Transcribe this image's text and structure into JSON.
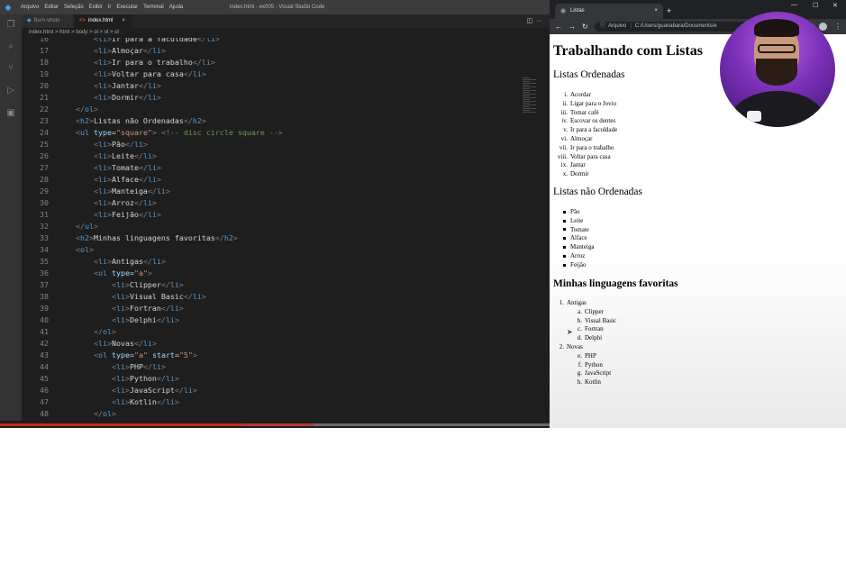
{
  "vscode": {
    "menu": [
      "Arquivo",
      "Editar",
      "Seleção",
      "Exibir",
      "Ir",
      "Executar",
      "Terminal",
      "Ajuda"
    ],
    "window_title": "index.html - ex005 - Visual Studio Code",
    "tabs": [
      {
        "label": "Bem-vindo",
        "active": false
      },
      {
        "label": "index.html",
        "active": true
      }
    ],
    "breadcrumb": "index.html > html > body > ol > ol > ol"
  },
  "code_lines": [
    {
      "n": "16",
      "indent": 2,
      "tokens": [
        {
          "t": "br",
          "v": "<"
        },
        {
          "t": "tag",
          "v": "li"
        },
        {
          "t": "br",
          "v": ">"
        },
        {
          "t": "txt",
          "v": "Ir para a faculdade"
        },
        {
          "t": "br",
          "v": "</"
        },
        {
          "t": "tag",
          "v": "li"
        },
        {
          "t": "br",
          "v": ">"
        }
      ]
    },
    {
      "n": "17",
      "indent": 2,
      "tokens": [
        {
          "t": "br",
          "v": "<"
        },
        {
          "t": "tag",
          "v": "li"
        },
        {
          "t": "br",
          "v": ">"
        },
        {
          "t": "txt",
          "v": "Almoçar"
        },
        {
          "t": "br",
          "v": "</"
        },
        {
          "t": "tag",
          "v": "li"
        },
        {
          "t": "br",
          "v": ">"
        }
      ]
    },
    {
      "n": "18",
      "indent": 2,
      "tokens": [
        {
          "t": "br",
          "v": "<"
        },
        {
          "t": "tag",
          "v": "li"
        },
        {
          "t": "br",
          "v": ">"
        },
        {
          "t": "txt",
          "v": "Ir para o trabalho"
        },
        {
          "t": "br",
          "v": "</"
        },
        {
          "t": "tag",
          "v": "li"
        },
        {
          "t": "br",
          "v": ">"
        }
      ]
    },
    {
      "n": "19",
      "indent": 2,
      "tokens": [
        {
          "t": "br",
          "v": "<"
        },
        {
          "t": "tag",
          "v": "li"
        },
        {
          "t": "br",
          "v": ">"
        },
        {
          "t": "txt",
          "v": "Voltar para casa"
        },
        {
          "t": "br",
          "v": "</"
        },
        {
          "t": "tag",
          "v": "li"
        },
        {
          "t": "br",
          "v": ">"
        }
      ]
    },
    {
      "n": "20",
      "indent": 2,
      "tokens": [
        {
          "t": "br",
          "v": "<"
        },
        {
          "t": "tag",
          "v": "li"
        },
        {
          "t": "br",
          "v": ">"
        },
        {
          "t": "txt",
          "v": "Jantar"
        },
        {
          "t": "br",
          "v": "</"
        },
        {
          "t": "tag",
          "v": "li"
        },
        {
          "t": "br",
          "v": ">"
        }
      ]
    },
    {
      "n": "21",
      "indent": 2,
      "tokens": [
        {
          "t": "br",
          "v": "<"
        },
        {
          "t": "tag",
          "v": "li"
        },
        {
          "t": "br",
          "v": ">"
        },
        {
          "t": "txt",
          "v": "Dormir"
        },
        {
          "t": "br",
          "v": "</"
        },
        {
          "t": "tag",
          "v": "li"
        },
        {
          "t": "br",
          "v": ">"
        }
      ]
    },
    {
      "n": "22",
      "indent": 1,
      "tokens": [
        {
          "t": "br",
          "v": "</"
        },
        {
          "t": "tag",
          "v": "ol"
        },
        {
          "t": "br",
          "v": ">"
        }
      ]
    },
    {
      "n": "23",
      "indent": 1,
      "tokens": [
        {
          "t": "br",
          "v": "<"
        },
        {
          "t": "tag",
          "v": "h2"
        },
        {
          "t": "br",
          "v": ">"
        },
        {
          "t": "txt",
          "v": "Listas não Ordenadas"
        },
        {
          "t": "br",
          "v": "</"
        },
        {
          "t": "tag",
          "v": "h2"
        },
        {
          "t": "br",
          "v": ">"
        }
      ]
    },
    {
      "n": "24",
      "indent": 1,
      "tokens": [
        {
          "t": "br",
          "v": "<"
        },
        {
          "t": "tag",
          "v": "ul"
        },
        {
          "t": "txt",
          "v": " "
        },
        {
          "t": "attr",
          "v": "type"
        },
        {
          "t": "txt",
          "v": "="
        },
        {
          "t": "str",
          "v": "\"square\""
        },
        {
          "t": "br",
          "v": ">"
        },
        {
          "t": "txt",
          "v": " "
        },
        {
          "t": "com",
          "v": "<!-- disc circle square -->"
        }
      ]
    },
    {
      "n": "25",
      "indent": 2,
      "tokens": [
        {
          "t": "br",
          "v": "<"
        },
        {
          "t": "tag",
          "v": "li"
        },
        {
          "t": "br",
          "v": ">"
        },
        {
          "t": "txt",
          "v": "Pão"
        },
        {
          "t": "br",
          "v": "</"
        },
        {
          "t": "tag",
          "v": "li"
        },
        {
          "t": "br",
          "v": ">"
        }
      ]
    },
    {
      "n": "26",
      "indent": 2,
      "tokens": [
        {
          "t": "br",
          "v": "<"
        },
        {
          "t": "tag",
          "v": "li"
        },
        {
          "t": "br",
          "v": ">"
        },
        {
          "t": "txt",
          "v": "Leite"
        },
        {
          "t": "br",
          "v": "</"
        },
        {
          "t": "tag",
          "v": "li"
        },
        {
          "t": "br",
          "v": ">"
        }
      ]
    },
    {
      "n": "27",
      "indent": 2,
      "tokens": [
        {
          "t": "br",
          "v": "<"
        },
        {
          "t": "tag",
          "v": "li"
        },
        {
          "t": "br",
          "v": ">"
        },
        {
          "t": "txt",
          "v": "Tomate"
        },
        {
          "t": "br",
          "v": "</"
        },
        {
          "t": "tag",
          "v": "li"
        },
        {
          "t": "br",
          "v": ">"
        }
      ]
    },
    {
      "n": "28",
      "indent": 2,
      "tokens": [
        {
          "t": "br",
          "v": "<"
        },
        {
          "t": "tag",
          "v": "li"
        },
        {
          "t": "br",
          "v": ">"
        },
        {
          "t": "txt",
          "v": "Alface"
        },
        {
          "t": "br",
          "v": "</"
        },
        {
          "t": "tag",
          "v": "li"
        },
        {
          "t": "br",
          "v": ">"
        }
      ]
    },
    {
      "n": "29",
      "indent": 2,
      "tokens": [
        {
          "t": "br",
          "v": "<"
        },
        {
          "t": "tag",
          "v": "li"
        },
        {
          "t": "br",
          "v": ">"
        },
        {
          "t": "txt",
          "v": "Manteiga"
        },
        {
          "t": "br",
          "v": "</"
        },
        {
          "t": "tag",
          "v": "li"
        },
        {
          "t": "br",
          "v": ">"
        }
      ]
    },
    {
      "n": "30",
      "indent": 2,
      "tokens": [
        {
          "t": "br",
          "v": "<"
        },
        {
          "t": "tag",
          "v": "li"
        },
        {
          "t": "br",
          "v": ">"
        },
        {
          "t": "txt",
          "v": "Arroz"
        },
        {
          "t": "br",
          "v": "</"
        },
        {
          "t": "tag",
          "v": "li"
        },
        {
          "t": "br",
          "v": ">"
        }
      ]
    },
    {
      "n": "31",
      "indent": 2,
      "tokens": [
        {
          "t": "br",
          "v": "<"
        },
        {
          "t": "tag",
          "v": "li"
        },
        {
          "t": "br",
          "v": ">"
        },
        {
          "t": "txt",
          "v": "Feijão"
        },
        {
          "t": "br",
          "v": "</"
        },
        {
          "t": "tag",
          "v": "li"
        },
        {
          "t": "br",
          "v": ">"
        }
      ]
    },
    {
      "n": "32",
      "indent": 1,
      "tokens": [
        {
          "t": "br",
          "v": "</"
        },
        {
          "t": "tag",
          "v": "ul"
        },
        {
          "t": "br",
          "v": ">"
        }
      ]
    },
    {
      "n": "33",
      "indent": 1,
      "tokens": [
        {
          "t": "br",
          "v": "<"
        },
        {
          "t": "tag",
          "v": "h2"
        },
        {
          "t": "br",
          "v": ">"
        },
        {
          "t": "txt",
          "v": "Minhas linguagens favoritas"
        },
        {
          "t": "br",
          "v": "</"
        },
        {
          "t": "tag",
          "v": "h2"
        },
        {
          "t": "br",
          "v": ">"
        }
      ]
    },
    {
      "n": "34",
      "indent": 1,
      "tokens": [
        {
          "t": "br",
          "v": "<"
        },
        {
          "t": "tag",
          "v": "ol"
        },
        {
          "t": "br",
          "v": ">"
        }
      ]
    },
    {
      "n": "35",
      "indent": 2,
      "tokens": [
        {
          "t": "br",
          "v": "<"
        },
        {
          "t": "tag",
          "v": "li"
        },
        {
          "t": "br",
          "v": ">"
        },
        {
          "t": "txt",
          "v": "Antigas"
        },
        {
          "t": "br",
          "v": "</"
        },
        {
          "t": "tag",
          "v": "li"
        },
        {
          "t": "br",
          "v": ">"
        }
      ]
    },
    {
      "n": "36",
      "indent": 2,
      "tokens": [
        {
          "t": "br",
          "v": "<"
        },
        {
          "t": "tag",
          "v": "ol"
        },
        {
          "t": "txt",
          "v": " "
        },
        {
          "t": "attr",
          "v": "type"
        },
        {
          "t": "txt",
          "v": "="
        },
        {
          "t": "str",
          "v": "\"a\""
        },
        {
          "t": "br",
          "v": ">"
        }
      ]
    },
    {
      "n": "37",
      "indent": 3,
      "tokens": [
        {
          "t": "br",
          "v": "<"
        },
        {
          "t": "tag",
          "v": "li"
        },
        {
          "t": "br",
          "v": ">"
        },
        {
          "t": "txt",
          "v": "Clipper"
        },
        {
          "t": "br",
          "v": "</"
        },
        {
          "t": "tag",
          "v": "li"
        },
        {
          "t": "br",
          "v": ">"
        }
      ]
    },
    {
      "n": "38",
      "indent": 3,
      "tokens": [
        {
          "t": "br",
          "v": "<"
        },
        {
          "t": "tag",
          "v": "li"
        },
        {
          "t": "br",
          "v": ">"
        },
        {
          "t": "txt",
          "v": "Visual Basic"
        },
        {
          "t": "br",
          "v": "</"
        },
        {
          "t": "tag",
          "v": "li"
        },
        {
          "t": "br",
          "v": ">"
        }
      ]
    },
    {
      "n": "39",
      "indent": 3,
      "tokens": [
        {
          "t": "br",
          "v": "<"
        },
        {
          "t": "tag",
          "v": "li"
        },
        {
          "t": "br",
          "v": ">"
        },
        {
          "t": "txt",
          "v": "Fortran"
        },
        {
          "t": "br",
          "v": "</"
        },
        {
          "t": "tag",
          "v": "li"
        },
        {
          "t": "br",
          "v": ">"
        }
      ]
    },
    {
      "n": "40",
      "indent": 3,
      "tokens": [
        {
          "t": "br",
          "v": "<"
        },
        {
          "t": "tag",
          "v": "li"
        },
        {
          "t": "br",
          "v": ">"
        },
        {
          "t": "txt",
          "v": "Delphi"
        },
        {
          "t": "br",
          "v": "</"
        },
        {
          "t": "tag",
          "v": "li"
        },
        {
          "t": "br",
          "v": ">"
        }
      ]
    },
    {
      "n": "41",
      "indent": 2,
      "tokens": [
        {
          "t": "br",
          "v": "</"
        },
        {
          "t": "tag",
          "v": "ol"
        },
        {
          "t": "br",
          "v": ">"
        }
      ]
    },
    {
      "n": "42",
      "indent": 2,
      "tokens": [
        {
          "t": "br",
          "v": "<"
        },
        {
          "t": "tag",
          "v": "li"
        },
        {
          "t": "br",
          "v": ">"
        },
        {
          "t": "txt",
          "v": "Novas"
        },
        {
          "t": "br",
          "v": "</"
        },
        {
          "t": "tag",
          "v": "li"
        },
        {
          "t": "br",
          "v": ">"
        }
      ]
    },
    {
      "n": "43",
      "indent": 2,
      "tokens": [
        {
          "t": "br",
          "v": "<"
        },
        {
          "t": "tag",
          "v": "ol"
        },
        {
          "t": "txt",
          "v": " "
        },
        {
          "t": "attr",
          "v": "type"
        },
        {
          "t": "txt",
          "v": "="
        },
        {
          "t": "str",
          "v": "\"a\""
        },
        {
          "t": "txt",
          "v": " "
        },
        {
          "t": "attr",
          "v": "start"
        },
        {
          "t": "txt",
          "v": "="
        },
        {
          "t": "str",
          "v": "\"5\""
        },
        {
          "t": "br",
          "v": ">"
        }
      ]
    },
    {
      "n": "44",
      "indent": 3,
      "tokens": [
        {
          "t": "br",
          "v": "<"
        },
        {
          "t": "tag",
          "v": "li"
        },
        {
          "t": "br",
          "v": ">"
        },
        {
          "t": "txt",
          "v": "PHP"
        },
        {
          "t": "br",
          "v": "</"
        },
        {
          "t": "tag",
          "v": "li"
        },
        {
          "t": "br",
          "v": ">"
        }
      ]
    },
    {
      "n": "45",
      "indent": 3,
      "tokens": [
        {
          "t": "br",
          "v": "<"
        },
        {
          "t": "tag",
          "v": "li"
        },
        {
          "t": "br",
          "v": ">"
        },
        {
          "t": "txt",
          "v": "Python"
        },
        {
          "t": "br",
          "v": "</"
        },
        {
          "t": "tag",
          "v": "li"
        },
        {
          "t": "br",
          "v": ">"
        }
      ]
    },
    {
      "n": "46",
      "indent": 3,
      "tokens": [
        {
          "t": "br",
          "v": "<"
        },
        {
          "t": "tag",
          "v": "li"
        },
        {
          "t": "br",
          "v": ">"
        },
        {
          "t": "txt",
          "v": "JavaScript"
        },
        {
          "t": "br",
          "v": "</"
        },
        {
          "t": "tag",
          "v": "li"
        },
        {
          "t": "br",
          "v": ">"
        }
      ]
    },
    {
      "n": "47",
      "indent": 3,
      "tokens": [
        {
          "t": "br",
          "v": "<"
        },
        {
          "t": "tag",
          "v": "li"
        },
        {
          "t": "br",
          "v": ">"
        },
        {
          "t": "txt",
          "v": "Kotlin"
        },
        {
          "t": "br",
          "v": "</"
        },
        {
          "t": "tag",
          "v": "li"
        },
        {
          "t": "br",
          "v": ">"
        }
      ]
    },
    {
      "n": "48",
      "indent": 2,
      "tokens": [
        {
          "t": "br",
          "v": "</"
        },
        {
          "t": "tag",
          "v": "ol"
        },
        {
          "t": "br",
          "v": ">"
        }
      ]
    }
  ],
  "browser": {
    "tab_title": "Listas",
    "new_tab": "+",
    "address_prefix": "Arquivo",
    "address_path": "C:/Users/guanabara/Documents/e",
    "page": {
      "h1": "Trabalhando com Listas",
      "section1_title": "Listas Ordenadas",
      "ordered_items": [
        {
          "marker": "i.",
          "text": "Acordar"
        },
        {
          "marker": "ii.",
          "text": "Ligar para o Jovio"
        },
        {
          "marker": "iii.",
          "text": "Tomar café"
        },
        {
          "marker": "iv.",
          "text": "Escovar os dentes"
        },
        {
          "marker": "v.",
          "text": "Ir para a faculdade"
        },
        {
          "marker": "vi.",
          "text": "Almoçar"
        },
        {
          "marker": "vii.",
          "text": "Ir para o trabalho"
        },
        {
          "marker": "viii.",
          "text": "Voltar para casa"
        },
        {
          "marker": "ix.",
          "text": "Jantar"
        },
        {
          "marker": "x.",
          "text": "Dormir"
        }
      ],
      "section2_title": "Listas não Ordenadas",
      "unordered_items": [
        "Pão",
        "Leite",
        "Tomate",
        "Alface",
        "Manteiga",
        "Arroz",
        "Feijão"
      ],
      "section3_title": "Minhas linguagens favoritas",
      "fav_groups": [
        {
          "marker": "1.",
          "text": "Antigas",
          "children": [
            {
              "marker": "a.",
              "text": "Clipper"
            },
            {
              "marker": "b.",
              "text": "Visual Basic"
            },
            {
              "marker": "c.",
              "text": "Fortran"
            },
            {
              "marker": "d.",
              "text": "Delphi"
            }
          ]
        },
        {
          "marker": "2.",
          "text": "Novas",
          "children": [
            {
              "marker": "e.",
              "text": "PHP"
            },
            {
              "marker": "f.",
              "text": "Python"
            },
            {
              "marker": "g.",
              "text": "JavaScript"
            },
            {
              "marker": "h.",
              "text": "Kotlin"
            }
          ]
        }
      ]
    }
  },
  "colors": {
    "editor_bg": "#1e1e1e",
    "tag": "#569cd6",
    "attr": "#9cdcfe",
    "string": "#ce9178",
    "comment": "#6a9955",
    "webcam_bg": "#7a2fb8",
    "status_red": "#c42b1c"
  },
  "icons": {
    "vscode_logo": "vscode-logo-icon",
    "activity": [
      "explorer-icon",
      "search-icon",
      "source-control-icon",
      "run-debug-icon",
      "extensions-icon"
    ],
    "browser_nav": [
      "back-icon",
      "forward-icon",
      "reload-icon",
      "info-icon"
    ]
  }
}
